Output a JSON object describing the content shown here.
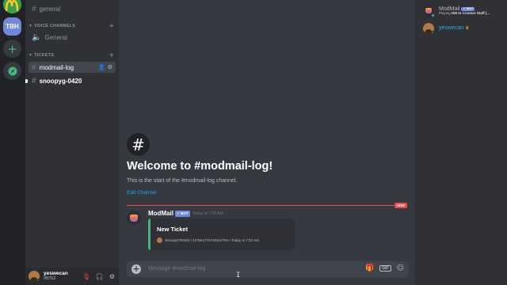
{
  "rail": {
    "servers": [
      {
        "label": "TBH"
      }
    ],
    "add_label": "+"
  },
  "channels": {
    "text_top": "general",
    "voice_category": "VOICE CHANNELS",
    "voice_channel": "General",
    "tickets_category": "TICKETS",
    "ticket_channels": [
      "modmail-log",
      "snoopyg-0420"
    ]
  },
  "user_panel": {
    "username": "yeswecan",
    "discriminator": "#8762"
  },
  "chat": {
    "welcome_icon": "#",
    "welcome_title": "Welcome to #modmail-log!",
    "welcome_subtitle": "This is the start of the #modmail-log channel.",
    "edit_channel": "Edit Channel",
    "new_badge": "NEW",
    "message": {
      "author": "ModMail",
      "bot_tag": "✓ BOT",
      "timestamp": "Today at 7:03 AM",
      "embed": {
        "title": "New Ticket",
        "footer": "SnoopyG#0420 | 427664776746314753 • Today at 7:03 AM",
        "accent_color": "#43b581"
      }
    },
    "input_placeholder": "Message #modmail-log"
  },
  "members": [
    {
      "name": "ModMail",
      "bot_tag": "✓ BOT",
      "activity_prefix": "Playing",
      "activity": "DM to Contact Staff |..."
    },
    {
      "name": "yeswecan",
      "crown": "♛"
    }
  ],
  "colors": {
    "accent": "#7289da",
    "online": "#43b581",
    "new_divider": "#f04747",
    "link": "#00b0f4"
  }
}
